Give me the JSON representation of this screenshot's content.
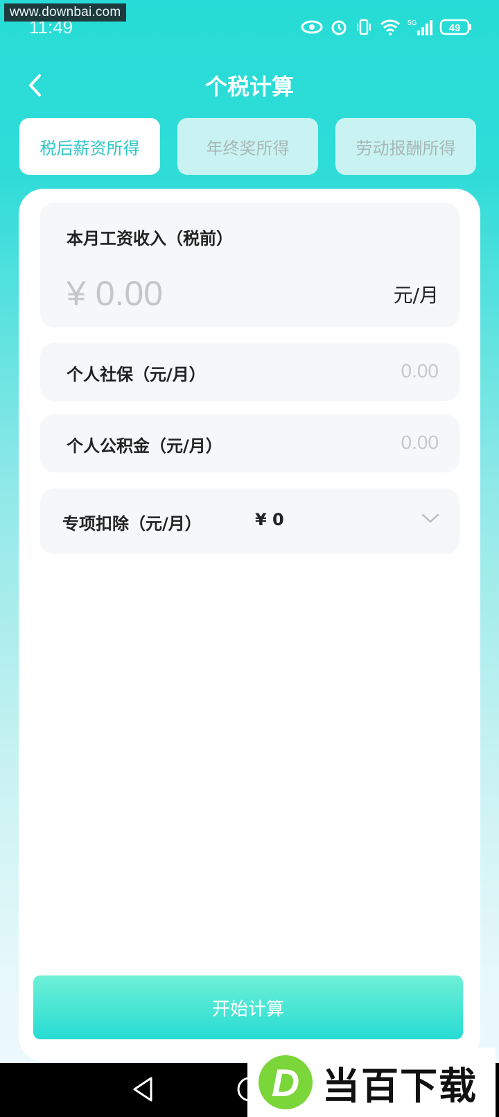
{
  "watermark": "www.downbai.com",
  "status_bar": {
    "time": "11:49",
    "battery": "49",
    "network": "5G"
  },
  "header": {
    "title": "个税计算",
    "back_icon": "chevron-left-icon"
  },
  "tabs": [
    {
      "label": "税后薪资所得",
      "active": true
    },
    {
      "label": "年终奖所得",
      "active": false
    },
    {
      "label": "劳动报酬所得",
      "active": false
    }
  ],
  "salary": {
    "label": "本月工资收入（税前）",
    "value": "¥ 0.00",
    "unit": "元/月"
  },
  "social_insurance": {
    "label": "个人社保（元/月）",
    "value": "0.00"
  },
  "housing_fund": {
    "label": "个人公积金（元/月）",
    "value": "0.00"
  },
  "special_deduction": {
    "label": "专项扣除（元/月）",
    "value": "¥ 0"
  },
  "calculate_button": {
    "label": "开始计算"
  },
  "logo": {
    "mark": "D",
    "text": "当百下载"
  },
  "colors": {
    "accent": "#29c6c7",
    "background_top": "#27dcd6",
    "button": "#27dcd3"
  }
}
